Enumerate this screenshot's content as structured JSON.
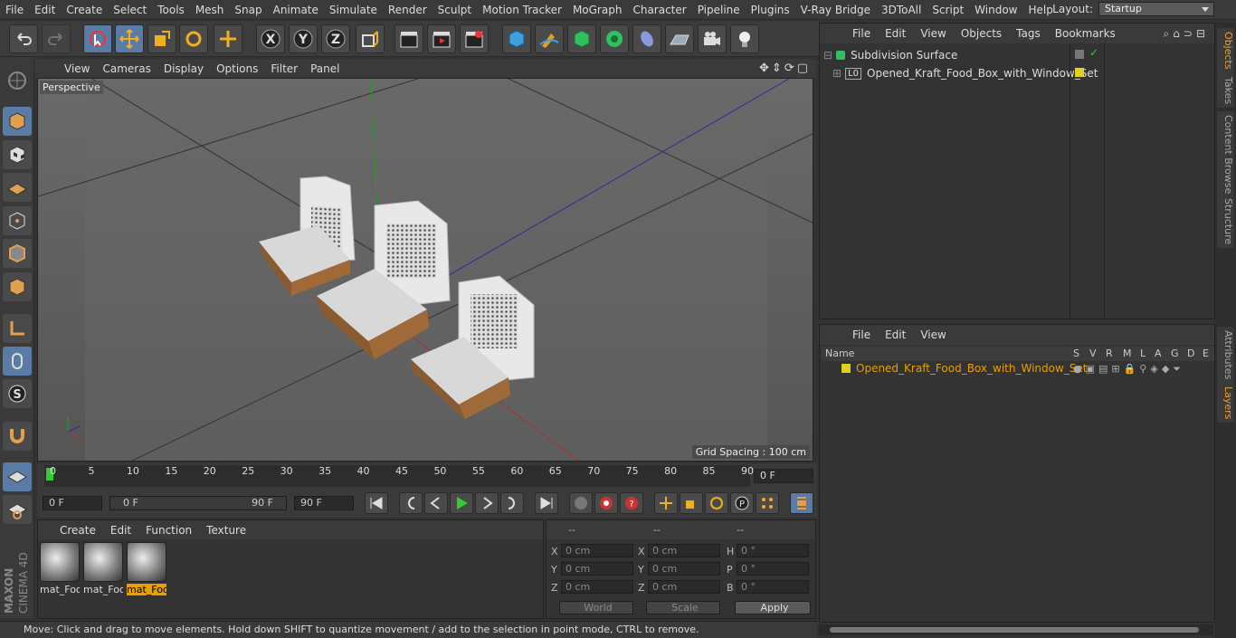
{
  "menubar": {
    "items": [
      "File",
      "Edit",
      "Create",
      "Select",
      "Tools",
      "Mesh",
      "Snap",
      "Animate",
      "Simulate",
      "Render",
      "Sculpt",
      "Motion Tracker",
      "MoGraph",
      "Character",
      "Pipeline",
      "Plugins",
      "V-Ray Bridge",
      "3DToAll",
      "Script",
      "Window",
      "Help"
    ],
    "layout_label": "Layout:",
    "layout_value": "Startup"
  },
  "viewport": {
    "menu": [
      "View",
      "Cameras",
      "Display",
      "Options",
      "Filter",
      "Panel"
    ],
    "label": "Perspective",
    "grid_spacing": "Grid Spacing : 100 cm"
  },
  "timeline": {
    "ticks": [
      "0",
      "5",
      "10",
      "15",
      "20",
      "25",
      "30",
      "35",
      "40",
      "45",
      "50",
      "55",
      "60",
      "65",
      "70",
      "75",
      "80",
      "85",
      "90"
    ],
    "current_frame": "0 F",
    "start_field": "0 F",
    "range_start": "0 F",
    "range_end": "90 F",
    "end_field": "90 F"
  },
  "materials": {
    "menu": [
      "Create",
      "Edit",
      "Function",
      "Texture"
    ],
    "items": [
      "mat_Foo",
      "mat_Foo",
      "mat_Foo"
    ]
  },
  "coords": {
    "headers": [
      "--",
      "--",
      "--"
    ],
    "rows": [
      {
        "l1": "X",
        "v1": "0 cm",
        "l2": "X",
        "v2": "0 cm",
        "l3": "H",
        "v3": "0 °"
      },
      {
        "l1": "Y",
        "v1": "0 cm",
        "l2": "Y",
        "v2": "0 cm",
        "l3": "P",
        "v3": "0 °"
      },
      {
        "l1": "Z",
        "v1": "0 cm",
        "l2": "Z",
        "v2": "0 cm",
        "l3": "B",
        "v3": "0 °"
      }
    ],
    "world": "World",
    "scale": "Scale",
    "apply": "Apply"
  },
  "status": "Move: Click and drag to move elements. Hold down SHIFT to quantize movement / add to the selection in point mode, CTRL to remove.",
  "objects": {
    "menu": [
      "File",
      "Edit",
      "View",
      "Objects",
      "Tags",
      "Bookmarks"
    ],
    "rows": [
      "Subdivision Surface",
      "Opened_Kraft_Food_Box_with_Window_Set"
    ]
  },
  "layers": {
    "menu": [
      "File",
      "Edit",
      "View"
    ],
    "name_header": "Name",
    "cols": [
      "S",
      "V",
      "R",
      "M",
      "L",
      "A",
      "G",
      "D",
      "E"
    ],
    "row": "Opened_Kraft_Food_Box_with_Window_Set"
  },
  "right_tabs": [
    "Objects",
    "Takes",
    "Content Browser",
    "Structure",
    "Attributes",
    "Layers"
  ],
  "brand": {
    "maxon": "MAXON",
    "product": "CINEMA 4D"
  },
  "colors": {
    "accent": "#5a7ba6",
    "layer": "#e0d020",
    "active_label": "#e8a000"
  }
}
